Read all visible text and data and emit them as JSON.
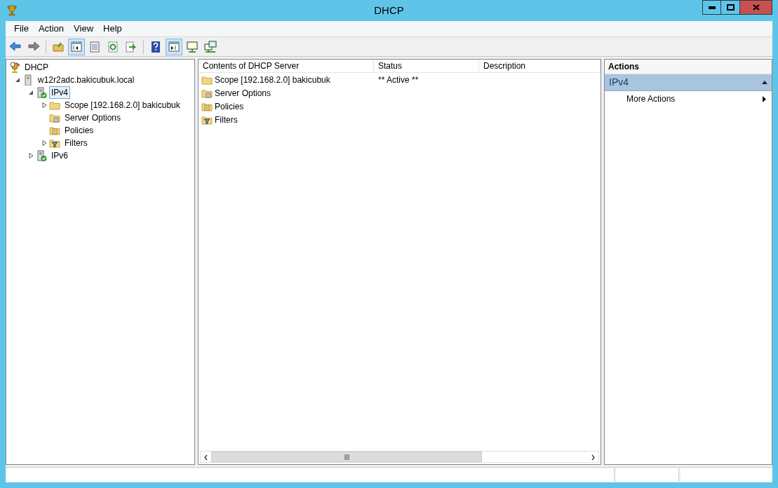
{
  "window": {
    "title": "DHCP"
  },
  "menu": [
    "File",
    "Action",
    "View",
    "Help"
  ],
  "toolbar": [
    [
      {
        "kind": "back",
        "pressed": false
      },
      {
        "kind": "forward",
        "pressed": false
      }
    ],
    [
      {
        "kind": "up",
        "pressed": false
      },
      {
        "kind": "tree",
        "pressed": true
      },
      {
        "kind": "props",
        "pressed": false
      },
      {
        "kind": "refresh",
        "pressed": false
      },
      {
        "kind": "export",
        "pressed": false
      }
    ],
    [
      {
        "kind": "help",
        "pressed": false
      },
      {
        "kind": "pane",
        "pressed": true
      },
      {
        "kind": "server",
        "pressed": false
      },
      {
        "kind": "servers",
        "pressed": false
      }
    ]
  ],
  "tree": [
    {
      "label": "DHCP",
      "kind": "dhcp",
      "selected": false,
      "children": [
        {
          "label": "w12r2adc.bakicubuk.local",
          "kind": "server",
          "selected": false,
          "expanded": true,
          "children": [
            {
              "label": "IPv4",
              "kind": "ip",
              "selected": true,
              "expanded": true,
              "children": [
                {
                  "label": "Scope [192.168.2.0] bakicubuk",
                  "kind": "folder",
                  "selected": false,
                  "expanded": false
                },
                {
                  "label": "Server Options",
                  "kind": "options",
                  "selected": false
                },
                {
                  "label": "Policies",
                  "kind": "policies",
                  "selected": false
                },
                {
                  "label": "Filters",
                  "kind": "filters",
                  "selected": false,
                  "expanded": false
                }
              ]
            },
            {
              "label": "IPv6",
              "kind": "ip",
              "selected": false,
              "expanded": false
            }
          ]
        }
      ]
    }
  ],
  "table": {
    "columns": [
      "Contents of DHCP Server",
      "Status",
      "Description"
    ],
    "rows": [
      {
        "name": "Scope [192.168.2.0] bakicubuk",
        "kind": "folder",
        "status": "** Active **"
      },
      {
        "name": "Server Options",
        "kind": "options"
      },
      {
        "name": "Policies",
        "kind": "policies"
      },
      {
        "name": "Filters",
        "kind": "filters"
      }
    ]
  },
  "actions": {
    "title": "Actions",
    "section": "IPv4",
    "items": [
      "More Actions"
    ]
  }
}
